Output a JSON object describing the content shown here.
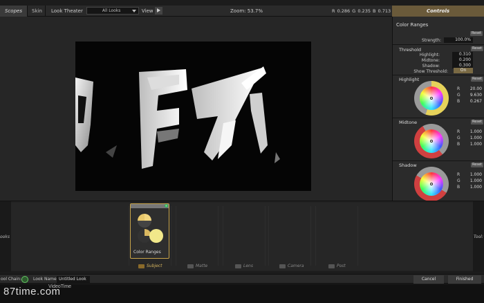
{
  "topbar": {
    "tab_scopes": "Scopes",
    "tab_skin": "Skin",
    "look_theater_label": "Look Theater",
    "look_select_value": "All Looks",
    "view_label": "View",
    "zoom_text": "Zoom:  53.7%",
    "rgb_readout": "R 0.286   G 0.235   B 0.713"
  },
  "controls": {
    "header": "Controls",
    "title": "Color Ranges",
    "reset_label": "Reset",
    "strength_label": "Strength:",
    "strength_value": "100.0%",
    "threshold": {
      "title": "Threshold",
      "highlight_label": "Highlight:",
      "highlight_value": "0.310",
      "midtone_label": "Midtone:",
      "midtone_value": "0.200",
      "shadow_label": "Shadow:",
      "shadow_value": "0.300",
      "show_label": "Show Threshold:",
      "show_value": "On"
    },
    "wheels": [
      {
        "title": "Highlight",
        "r": "20.00",
        "g": "9.630",
        "b": "0.267"
      },
      {
        "title": "Midtone",
        "r": "1.000",
        "g": "1.000",
        "b": "1.000"
      },
      {
        "title": "Shadow",
        "r": "1.000",
        "g": "1.000",
        "b": "1.000"
      }
    ],
    "r_label": "R",
    "g_label": "G",
    "b_label": "B"
  },
  "tool_strip": {
    "left_label": "ooks",
    "right_label": "Tool:",
    "tile_label": "Color Ranges",
    "categories": [
      "Subject",
      "Matte",
      "Lens",
      "Camera",
      "Post"
    ]
  },
  "bottombar": {
    "tool_chain_label": "ool Chain:",
    "look_name_label": "Look Name:",
    "look_name_value": "Untitled Look",
    "cancel": "Cancel",
    "finished": "Finished"
  },
  "watermark": {
    "main": "87time.com",
    "sub": "VideoTime"
  },
  "colors": {
    "accent": "#c8a44a",
    "controls_header": "#6a5a3a",
    "power_on": "#66cc66"
  }
}
